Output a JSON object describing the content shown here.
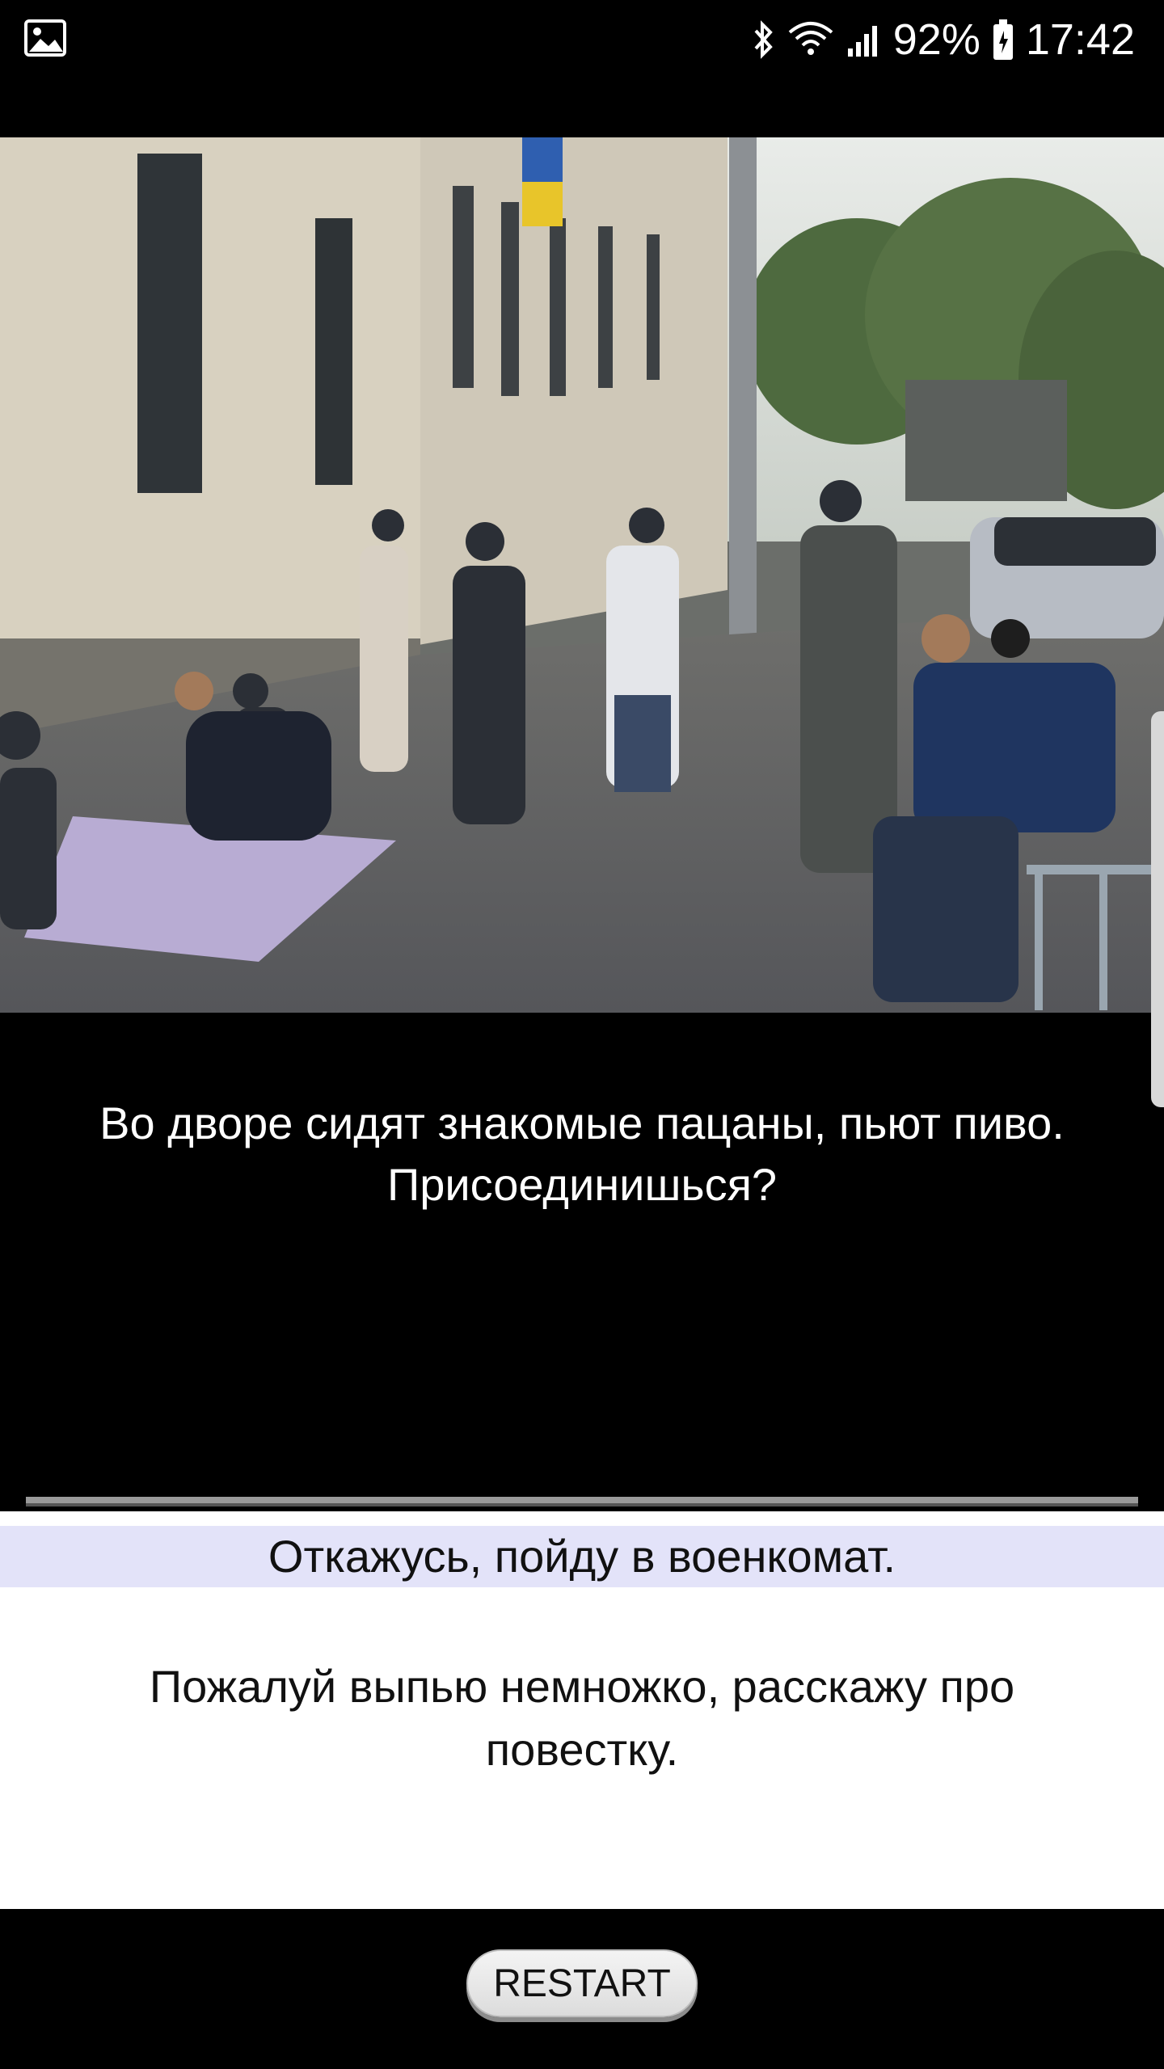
{
  "status_bar": {
    "battery": "92%",
    "time": "17:42",
    "icons": [
      "gallery-notification-icon",
      "bluetooth-icon",
      "wifi-icon",
      "signal-icon",
      "battery-icon"
    ]
  },
  "scene": {
    "image_icon": "photo-image"
  },
  "question": {
    "line1": "Во дворе сидят знакомые пацаны, пьют пиво.",
    "line2": "Присоединишься?"
  },
  "answers": [
    {
      "label": "Откажусь, пойду в военкомат."
    },
    {
      "label": "Пожалуй выпью немножко, расскажу про повестку."
    }
  ],
  "restart_label": "RESTART",
  "colors": {
    "background": "#000000",
    "answer_highlight": "#e3e3f9",
    "answers_panel": "#ffffff"
  }
}
